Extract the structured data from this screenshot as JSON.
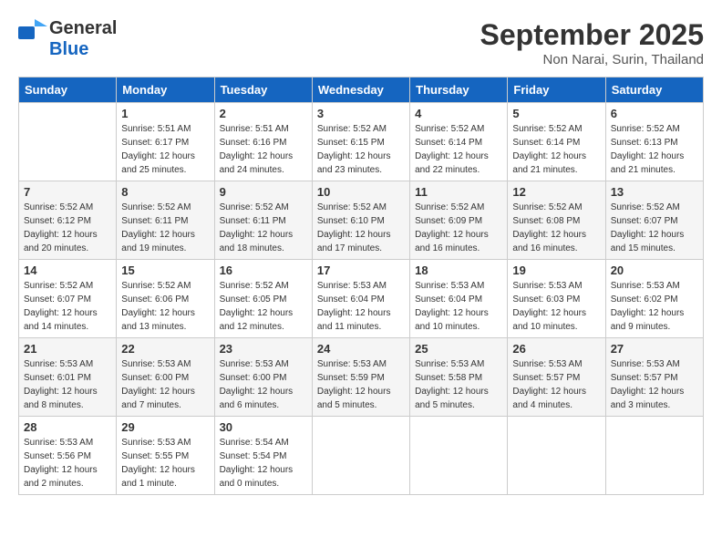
{
  "header": {
    "logo_general": "General",
    "logo_blue": "Blue",
    "month": "September 2025",
    "location": "Non Narai, Surin, Thailand"
  },
  "days_of_week": [
    "Sunday",
    "Monday",
    "Tuesday",
    "Wednesday",
    "Thursday",
    "Friday",
    "Saturday"
  ],
  "weeks": [
    [
      {
        "day": "",
        "sunrise": "",
        "sunset": "",
        "daylight": ""
      },
      {
        "day": "1",
        "sunrise": "Sunrise: 5:51 AM",
        "sunset": "Sunset: 6:17 PM",
        "daylight": "Daylight: 12 hours and 25 minutes."
      },
      {
        "day": "2",
        "sunrise": "Sunrise: 5:51 AM",
        "sunset": "Sunset: 6:16 PM",
        "daylight": "Daylight: 12 hours and 24 minutes."
      },
      {
        "day": "3",
        "sunrise": "Sunrise: 5:52 AM",
        "sunset": "Sunset: 6:15 PM",
        "daylight": "Daylight: 12 hours and 23 minutes."
      },
      {
        "day": "4",
        "sunrise": "Sunrise: 5:52 AM",
        "sunset": "Sunset: 6:14 PM",
        "daylight": "Daylight: 12 hours and 22 minutes."
      },
      {
        "day": "5",
        "sunrise": "Sunrise: 5:52 AM",
        "sunset": "Sunset: 6:14 PM",
        "daylight": "Daylight: 12 hours and 21 minutes."
      },
      {
        "day": "6",
        "sunrise": "Sunrise: 5:52 AM",
        "sunset": "Sunset: 6:13 PM",
        "daylight": "Daylight: 12 hours and 21 minutes."
      }
    ],
    [
      {
        "day": "7",
        "sunrise": "Sunrise: 5:52 AM",
        "sunset": "Sunset: 6:12 PM",
        "daylight": "Daylight: 12 hours and 20 minutes."
      },
      {
        "day": "8",
        "sunrise": "Sunrise: 5:52 AM",
        "sunset": "Sunset: 6:11 PM",
        "daylight": "Daylight: 12 hours and 19 minutes."
      },
      {
        "day": "9",
        "sunrise": "Sunrise: 5:52 AM",
        "sunset": "Sunset: 6:11 PM",
        "daylight": "Daylight: 12 hours and 18 minutes."
      },
      {
        "day": "10",
        "sunrise": "Sunrise: 5:52 AM",
        "sunset": "Sunset: 6:10 PM",
        "daylight": "Daylight: 12 hours and 17 minutes."
      },
      {
        "day": "11",
        "sunrise": "Sunrise: 5:52 AM",
        "sunset": "Sunset: 6:09 PM",
        "daylight": "Daylight: 12 hours and 16 minutes."
      },
      {
        "day": "12",
        "sunrise": "Sunrise: 5:52 AM",
        "sunset": "Sunset: 6:08 PM",
        "daylight": "Daylight: 12 hours and 16 minutes."
      },
      {
        "day": "13",
        "sunrise": "Sunrise: 5:52 AM",
        "sunset": "Sunset: 6:07 PM",
        "daylight": "Daylight: 12 hours and 15 minutes."
      }
    ],
    [
      {
        "day": "14",
        "sunrise": "Sunrise: 5:52 AM",
        "sunset": "Sunset: 6:07 PM",
        "daylight": "Daylight: 12 hours and 14 minutes."
      },
      {
        "day": "15",
        "sunrise": "Sunrise: 5:52 AM",
        "sunset": "Sunset: 6:06 PM",
        "daylight": "Daylight: 12 hours and 13 minutes."
      },
      {
        "day": "16",
        "sunrise": "Sunrise: 5:52 AM",
        "sunset": "Sunset: 6:05 PM",
        "daylight": "Daylight: 12 hours and 12 minutes."
      },
      {
        "day": "17",
        "sunrise": "Sunrise: 5:53 AM",
        "sunset": "Sunset: 6:04 PM",
        "daylight": "Daylight: 12 hours and 11 minutes."
      },
      {
        "day": "18",
        "sunrise": "Sunrise: 5:53 AM",
        "sunset": "Sunset: 6:04 PM",
        "daylight": "Daylight: 12 hours and 10 minutes."
      },
      {
        "day": "19",
        "sunrise": "Sunrise: 5:53 AM",
        "sunset": "Sunset: 6:03 PM",
        "daylight": "Daylight: 12 hours and 10 minutes."
      },
      {
        "day": "20",
        "sunrise": "Sunrise: 5:53 AM",
        "sunset": "Sunset: 6:02 PM",
        "daylight": "Daylight: 12 hours and 9 minutes."
      }
    ],
    [
      {
        "day": "21",
        "sunrise": "Sunrise: 5:53 AM",
        "sunset": "Sunset: 6:01 PM",
        "daylight": "Daylight: 12 hours and 8 minutes."
      },
      {
        "day": "22",
        "sunrise": "Sunrise: 5:53 AM",
        "sunset": "Sunset: 6:00 PM",
        "daylight": "Daylight: 12 hours and 7 minutes."
      },
      {
        "day": "23",
        "sunrise": "Sunrise: 5:53 AM",
        "sunset": "Sunset: 6:00 PM",
        "daylight": "Daylight: 12 hours and 6 minutes."
      },
      {
        "day": "24",
        "sunrise": "Sunrise: 5:53 AM",
        "sunset": "Sunset: 5:59 PM",
        "daylight": "Daylight: 12 hours and 5 minutes."
      },
      {
        "day": "25",
        "sunrise": "Sunrise: 5:53 AM",
        "sunset": "Sunset: 5:58 PM",
        "daylight": "Daylight: 12 hours and 5 minutes."
      },
      {
        "day": "26",
        "sunrise": "Sunrise: 5:53 AM",
        "sunset": "Sunset: 5:57 PM",
        "daylight": "Daylight: 12 hours and 4 minutes."
      },
      {
        "day": "27",
        "sunrise": "Sunrise: 5:53 AM",
        "sunset": "Sunset: 5:57 PM",
        "daylight": "Daylight: 12 hours and 3 minutes."
      }
    ],
    [
      {
        "day": "28",
        "sunrise": "Sunrise: 5:53 AM",
        "sunset": "Sunset: 5:56 PM",
        "daylight": "Daylight: 12 hours and 2 minutes."
      },
      {
        "day": "29",
        "sunrise": "Sunrise: 5:53 AM",
        "sunset": "Sunset: 5:55 PM",
        "daylight": "Daylight: 12 hours and 1 minute."
      },
      {
        "day": "30",
        "sunrise": "Sunrise: 5:54 AM",
        "sunset": "Sunset: 5:54 PM",
        "daylight": "Daylight: 12 hours and 0 minutes."
      },
      {
        "day": "",
        "sunrise": "",
        "sunset": "",
        "daylight": ""
      },
      {
        "day": "",
        "sunrise": "",
        "sunset": "",
        "daylight": ""
      },
      {
        "day": "",
        "sunrise": "",
        "sunset": "",
        "daylight": ""
      },
      {
        "day": "",
        "sunrise": "",
        "sunset": "",
        "daylight": ""
      }
    ]
  ]
}
